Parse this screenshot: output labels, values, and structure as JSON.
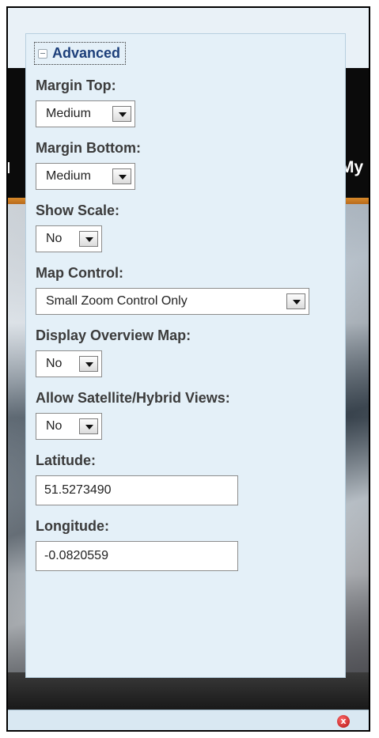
{
  "background": {
    "nav_left": "l",
    "nav_right": "My E"
  },
  "panel": {
    "legend": "Advanced",
    "fields": {
      "margin_top": {
        "label": "Margin Top:",
        "value": "Medium"
      },
      "margin_bottom": {
        "label": "Margin Bottom:",
        "value": "Medium"
      },
      "show_scale": {
        "label": "Show Scale:",
        "value": "No"
      },
      "map_control": {
        "label": "Map Control:",
        "value": "Small Zoom Control Only"
      },
      "display_overview": {
        "label": "Display Overview Map:",
        "value": "No"
      },
      "allow_satellite": {
        "label": "Allow Satellite/Hybrid Views:",
        "value": "No"
      },
      "latitude": {
        "label": "Latitude:",
        "value": "51.5273490"
      },
      "longitude": {
        "label": "Longitude:",
        "value": "-0.0820559"
      }
    }
  },
  "bottom_bar": {
    "close_icon_glyph": "x"
  },
  "colors": {
    "panel_bg": "#e4f0f8",
    "legend_text": "#1d3f7a",
    "orange_bar": "#d88a2a"
  }
}
